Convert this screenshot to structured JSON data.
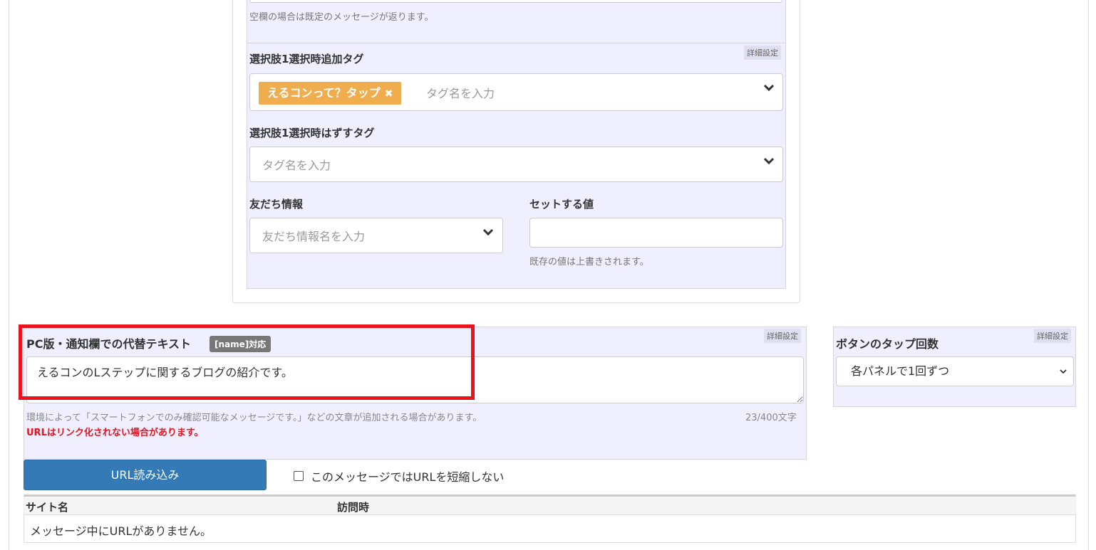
{
  "top_section": {
    "prev_help": "空欄の場合は既定のメッセージが返ります。",
    "detail_badge": "詳細設定",
    "add_tag_label": "選択肢1選択時追加タグ",
    "add_tag_chip": "えるコンって？タップ",
    "add_tag_chip_remove": "✖",
    "add_tag_placeholder": "タグ名を入力",
    "remove_tag_label": "選択肢1選択時はずすタグ",
    "remove_tag_placeholder": "タグ名を入力",
    "friend_info_label": "友だち情報",
    "friend_info_placeholder": "友だち情報名を入力",
    "set_value_label": "セットする値",
    "set_value_value": "",
    "set_value_help": "既存の値は上書きされます。"
  },
  "alt_text": {
    "label": "PC版・通知欄での代替テキスト",
    "badge": "[name]対応",
    "detail_badge": "詳細設定",
    "value": "えるコンのLステップに関するブログの紹介です。",
    "help": "環境によって「スマートフォンでのみ確認可能なメッセージです。」などの文章が追加される場合があります。",
    "count": "23/400文字",
    "warning": "URLはリンク化されない場合があります。"
  },
  "tap_count": {
    "label": "ボタンのタップ回数",
    "detail_badge": "詳細設定",
    "selected": "各パネルで1回ずつ"
  },
  "url_section": {
    "load_button": "URL読み込み",
    "no_shorten_label": "このメッセージではURLを短縮しない",
    "no_shorten_checked": false,
    "table": {
      "headers": [
        "サイト名",
        "訪問時"
      ],
      "empty_message": "メッセージ中にURLがありません。"
    }
  },
  "colors": {
    "accent": "#337ab7",
    "tag": "#f0ad4e",
    "warning": "#e8131c",
    "panel_bg": "#f0efff"
  }
}
